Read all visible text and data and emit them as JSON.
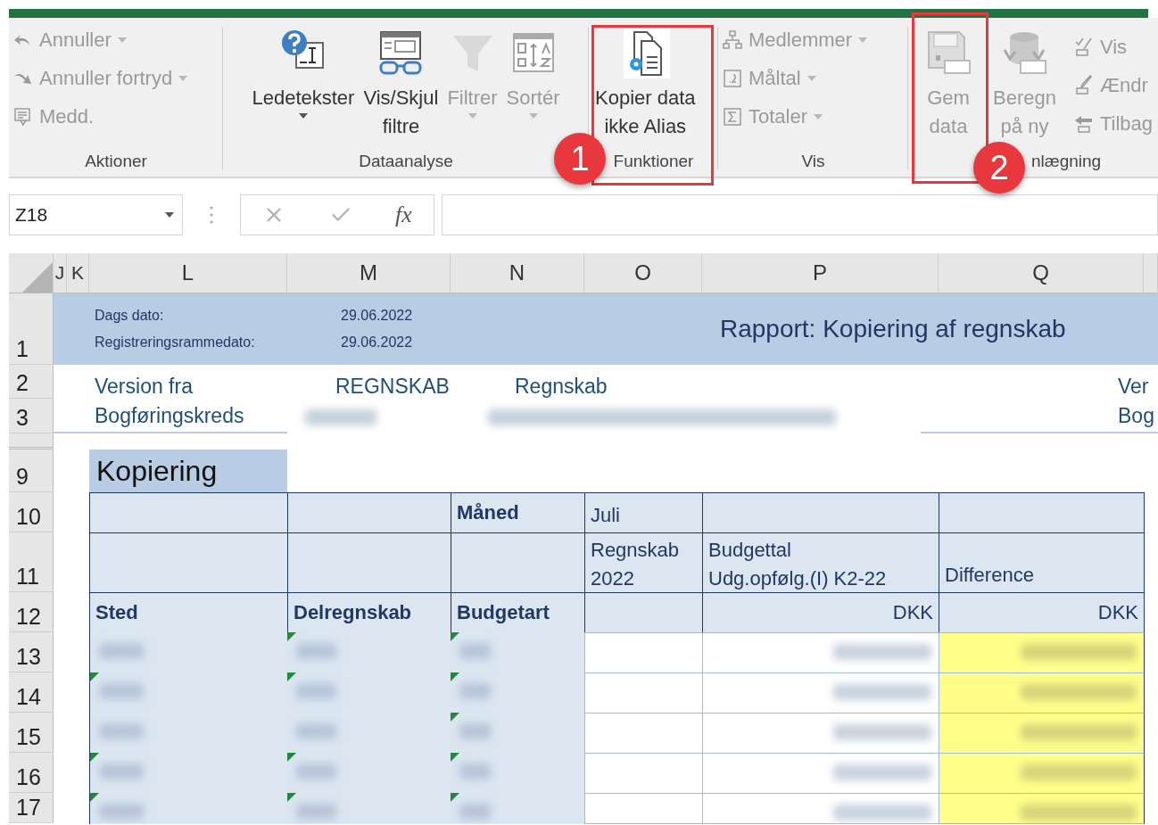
{
  "ribbon": {
    "groups": [
      {
        "label": "Aktioner",
        "items": [
          {
            "kind": "small",
            "label": "Annuller",
            "dropdown": true,
            "disabled": true
          },
          {
            "kind": "small",
            "label": "Annuller fortryd",
            "dropdown": true,
            "disabled": true
          },
          {
            "kind": "small",
            "label": "Medd.",
            "dropdown": false,
            "disabled": true
          }
        ]
      },
      {
        "label": "Dataanalyse",
        "items": [
          {
            "kind": "large",
            "label": "Ledetekster",
            "dropdown": true,
            "disabled": false
          },
          {
            "kind": "large",
            "label": "Vis/Skjul\nfiltre",
            "dropdown": false,
            "disabled": false
          },
          {
            "kind": "large",
            "label": "Filtrer",
            "dropdown": true,
            "disabled": true
          },
          {
            "kind": "large",
            "label": "Sortér",
            "dropdown": true,
            "disabled": true
          }
        ]
      },
      {
        "label": "Funktioner",
        "items": [
          {
            "kind": "large",
            "label": "Kopier data\nikke Alias",
            "dropdown": false,
            "disabled": false
          }
        ]
      },
      {
        "label": "Vis",
        "items": [
          {
            "kind": "small",
            "label": "Medlemmer",
            "dropdown": true,
            "disabled": true
          },
          {
            "kind": "small",
            "label": "Måltal",
            "dropdown": true,
            "disabled": true
          },
          {
            "kind": "small",
            "label": "Totaler",
            "dropdown": true,
            "disabled": true
          }
        ]
      },
      {
        "label": "nlægning",
        "items": [
          {
            "kind": "large",
            "label": "Gem\ndata",
            "dropdown": false,
            "disabled": true
          },
          {
            "kind": "large",
            "label": "Beregn\npå ny",
            "dropdown": false,
            "disabled": true
          },
          {
            "kind": "small",
            "label": "Vis",
            "dropdown": false,
            "disabled": true
          },
          {
            "kind": "small",
            "label": "Ændr",
            "dropdown": false,
            "disabled": true
          },
          {
            "kind": "small",
            "label": "Tilbag",
            "dropdown": false,
            "disabled": true
          }
        ]
      }
    ]
  },
  "annotations": [
    {
      "number": "1"
    },
    {
      "number": "2"
    }
  ],
  "name_box": "Z18",
  "formula_bar": {
    "fx": "fx"
  },
  "sheet": {
    "columns": [
      "J",
      "K",
      "L",
      "M",
      "N",
      "O",
      "P",
      "Q"
    ],
    "row_numbers": [
      "1",
      "2",
      "3",
      "9",
      "10",
      "11",
      "12",
      "13",
      "14",
      "15",
      "16",
      "17"
    ],
    "report": {
      "date_labels": [
        "Dags dato:",
        "Registreringsrammedato:"
      ],
      "dates": [
        "29.06.2022",
        "29.06.2022"
      ],
      "title": "Rapport: Kopiering af regnskab",
      "version_label": "Version fra",
      "version_value": "REGNSKAB",
      "version_name": "Regnskab",
      "version_label_2": "Ver",
      "bookkeeping_label": "Bogføringskreds",
      "bookkeeping_label_2": "Bog"
    },
    "section_title": "Kopiering",
    "table": {
      "month_label": "Måned",
      "month": "Juli",
      "column_headers": [
        "Regnskab\n2022",
        "Budgettal\nUdg.opfølg.(I) K2-22",
        "Difference"
      ],
      "headers": [
        "Sted",
        "Delregnskab",
        "Budgetart"
      ],
      "units": [
        "DKK",
        "DKK"
      ],
      "rows": [
        {
          "flags": [
            false,
            true,
            true
          ]
        },
        {
          "flags": [
            true,
            true,
            true
          ]
        },
        {
          "flags": [
            false,
            false,
            true
          ]
        },
        {
          "flags": [
            true,
            true,
            true
          ]
        },
        {
          "flags": [
            true,
            true,
            true
          ]
        }
      ]
    }
  }
}
